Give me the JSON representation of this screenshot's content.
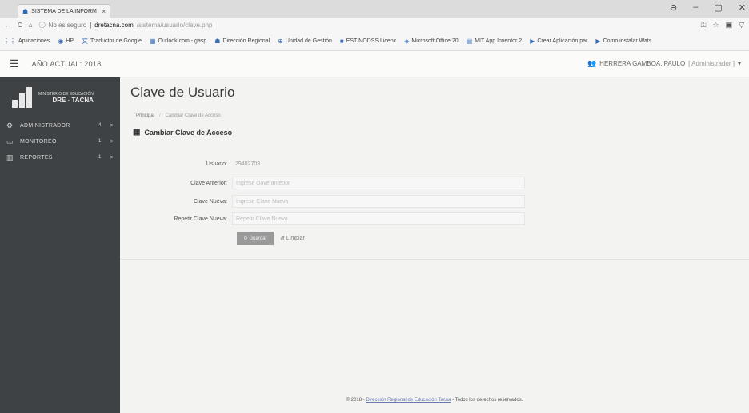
{
  "browser": {
    "tab_title": "SISTEMA DE LA INFORM",
    "tab_close": "×",
    "window_controls": [
      "⊖",
      "–",
      "▢",
      "✕"
    ],
    "address": {
      "security_label": "No es seguro",
      "domain": "dretacna.com",
      "path": "/sistema/usuario/clave.php"
    },
    "bookmarks": [
      {
        "icon": "apps-icon",
        "label": "Aplicaciones"
      },
      {
        "icon": "hp-icon",
        "label": "HP"
      },
      {
        "icon": "translate-icon",
        "label": "Traductor de Google"
      },
      {
        "icon": "outlook-icon",
        "label": "Outlook.com - gasp"
      },
      {
        "icon": "dre-icon",
        "label": "Dirección Regional"
      },
      {
        "icon": "link-icon",
        "label": "Unidad de Gestión"
      },
      {
        "icon": "bookmark-icon",
        "label": "EST NODSS Licenc"
      },
      {
        "icon": "office-icon",
        "label": "Microsoft Office 20"
      },
      {
        "icon": "app-icon",
        "label": "MIT App Inventor 2"
      },
      {
        "icon": "youtube-icon",
        "label": "Crear Aplicación par"
      },
      {
        "icon": "youtube-icon",
        "label": "Como instalar Wats"
      }
    ]
  },
  "header": {
    "year_label": "AÑO ACTUAL: 2018",
    "user_name": "HERRERA GAMBOA, PAULO",
    "user_role": "[ Administrador ]"
  },
  "sidebar": {
    "logo_line1": "MINISTERIO DE EDUCACIÓN",
    "logo_line2": "DRE - TACNA",
    "items": [
      {
        "icon": "gear-icon",
        "label": "ADMINISTRADOR",
        "badge": "4",
        "arrow": ">"
      },
      {
        "icon": "monitor-icon",
        "label": "MONITOREO",
        "badge": "1",
        "arrow": ">"
      },
      {
        "icon": "bar-chart-icon",
        "label": "REPORTES",
        "badge": "1",
        "arrow": ">"
      }
    ]
  },
  "main": {
    "title": "Clave de Usuario",
    "breadcrumb": [
      "Principal",
      "Cambiar Clave de Acceso"
    ],
    "section_title": "Cambiar Clave de Acceso",
    "form": {
      "usuario_label": "Usuario:",
      "usuario_value": "29402703",
      "clave_anterior_label": "Clave Anterior:",
      "clave_anterior_placeholder": "Ingrese clave anterior",
      "clave_nueva_label": "Clave Nueva:",
      "clave_nueva_placeholder": "Ingrese Clave Nueva",
      "repetir_label": "Repetir Clave Nueva:",
      "repetir_placeholder": "Repetir Clave Nueva"
    },
    "save_label": "Guardar",
    "clear_label": "Limpiar"
  },
  "footer": {
    "prefix": "© 2018 - ",
    "org": "Dirección Regional de Educación Tacna",
    "suffix": " - Todos los derechos reservados."
  }
}
